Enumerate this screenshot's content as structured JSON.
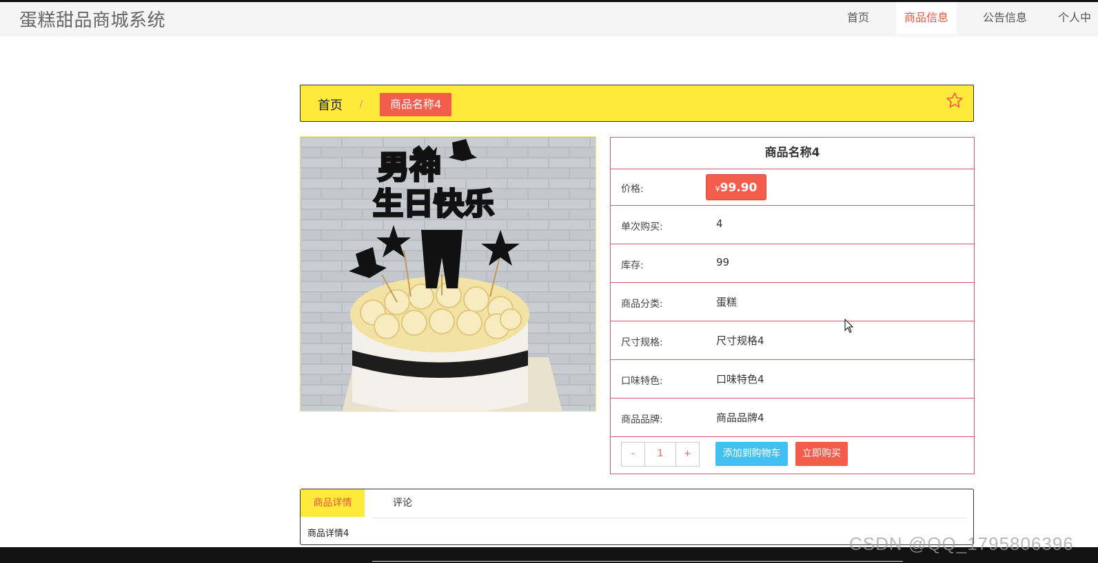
{
  "app": {
    "title": "蛋糕甜品商城系统"
  },
  "nav": {
    "items": [
      "首页",
      "商品信息",
      "公告信息",
      "个人中"
    ],
    "active_index": 1
  },
  "breadcrumb": {
    "home": "首页",
    "separator": "/",
    "current": "商品名称4"
  },
  "product": {
    "name": "商品名称4",
    "price_label": "价格:",
    "currency": "¥",
    "price": "99.90",
    "rows": [
      {
        "label": "单次购买:",
        "value": "4"
      },
      {
        "label": "库存:",
        "value": "99"
      },
      {
        "label": "商品分类:",
        "value": "蛋糕"
      },
      {
        "label": "尺寸规格:",
        "value": "尺寸规格4"
      },
      {
        "label": "口味特色:",
        "value": "口味特色4"
      },
      {
        "label": "商品品牌:",
        "value": "商品品牌4"
      }
    ],
    "quantity": {
      "minus": "-",
      "value": "1",
      "plus": "+"
    },
    "add_to_cart": "添加到购物车",
    "buy_now": "立即购买"
  },
  "image": {
    "topper_line1": "男神",
    "topper_line2": "生日快乐"
  },
  "tabs": {
    "details": "商品详情",
    "comments": "评论",
    "content": "商品详情4"
  },
  "watermark": "CSDN @QQ_1795806396",
  "colors": {
    "accent_yellow": "#ffe93b",
    "accent_red": "#f45d4c",
    "cart_blue": "#41c1f0",
    "border_pink": "#e0556a"
  },
  "icons": {
    "favorite": "star-outline-icon"
  }
}
